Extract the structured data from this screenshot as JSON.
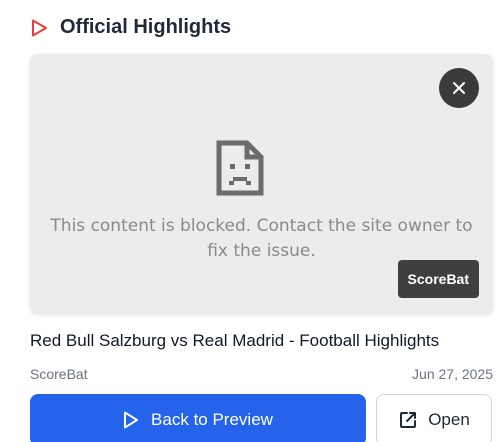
{
  "header": {
    "icon": "play-icon",
    "title": "Official Highlights",
    "icon_color": "#e53e3e"
  },
  "embed": {
    "close_icon": "close-icon",
    "blocked_icon": "sad-document-icon",
    "blocked_message": "This content is blocked. Contact the site owner to fix the issue.",
    "brand_badge": "ScoreBat"
  },
  "video": {
    "title": "Red Bull Salzburg vs Real Madrid - Football Highlights",
    "source": "ScoreBat",
    "date": "Jun 27, 2025"
  },
  "actions": {
    "back_label": "Back to Preview",
    "back_icon": "play-icon",
    "open_label": "Open",
    "open_icon": "external-link-icon",
    "primary_color": "#2563eb"
  }
}
